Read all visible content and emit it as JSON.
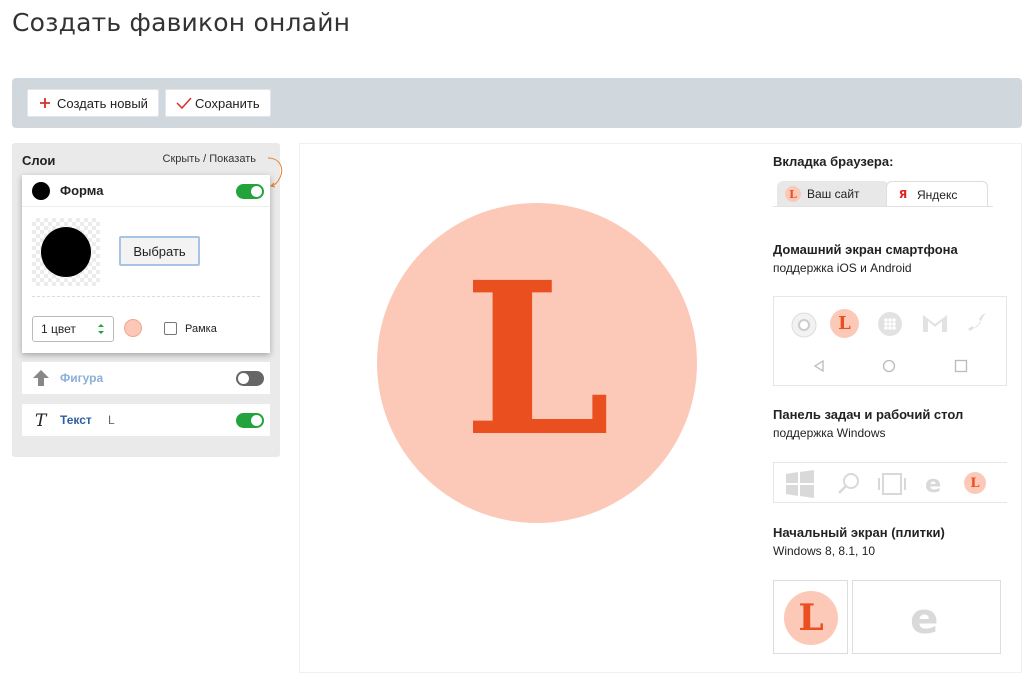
{
  "page": {
    "title": "Создать фавикон онлайн"
  },
  "toolbar": {
    "new_label": "Создать новый",
    "save_label": "Сохранить"
  },
  "layers": {
    "title": "Слои",
    "toggle_label": "Скрыть / Показать",
    "shape": {
      "label": "Форма",
      "enabled": true,
      "choose_label": "Выбрать",
      "colors_value": "1 цвет",
      "color": "#fcc7b7",
      "frame_label": "Рамка",
      "frame_checked": false
    },
    "figure": {
      "label": "Фигура",
      "enabled": false
    },
    "text": {
      "label": "Текст",
      "value": "L",
      "enabled": true
    }
  },
  "preview": {
    "letter": "L",
    "bg_color": "#fcc9b8",
    "letter_color": "#e94f1f"
  },
  "side": {
    "browser": {
      "title": "Вкладка браузера:",
      "tab_site": "Ваш сайт",
      "tab_yandex": "Яндекс",
      "yandex_icon": "Я"
    },
    "phone": {
      "title": "Домашний экран смартфона",
      "subtitle": "поддержка iOS и Android"
    },
    "taskbar": {
      "title": "Панель задач и рабочий стол",
      "subtitle": "поддержка Windows"
    },
    "tiles": {
      "title": "Начальный экран (плитки)",
      "subtitle": "Windows 8, 8.1, 10"
    }
  }
}
